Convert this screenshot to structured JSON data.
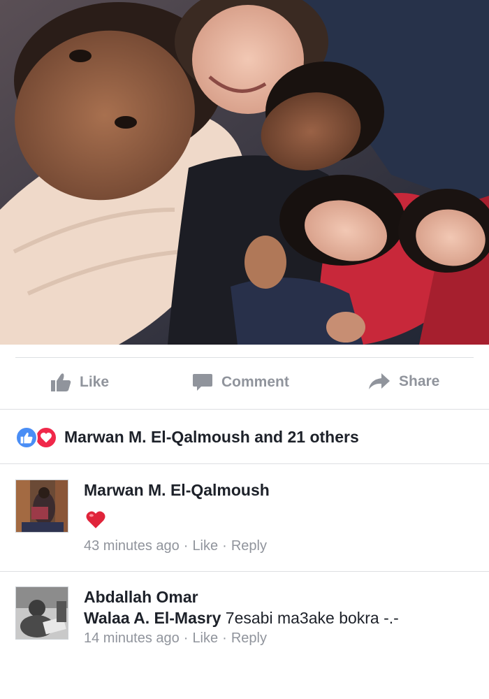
{
  "photo": {
    "alt_name": "group-selfie-photo"
  },
  "actions": {
    "like_label": "Like",
    "comment_label": "Comment",
    "share_label": "Share"
  },
  "reactions": {
    "summary": "Marwan M. El-Qalmoush and 21 others",
    "icons": [
      "like-reaction-icon",
      "love-reaction-icon"
    ]
  },
  "comments": [
    {
      "author": "Marwan M. El-Qalmoush",
      "content_icon": "red-heart-emoji",
      "time": "43 minutes ago",
      "like_label": "Like",
      "reply_label": "Reply"
    },
    {
      "author": "Abdallah Omar",
      "mention": "Walaa A. El-Masry",
      "text": " 7esabi ma3ake bokra -.-",
      "time": "14 minutes ago",
      "like_label": "Like",
      "reply_label": "Reply"
    }
  ],
  "colors": {
    "muted_text": "#90949c",
    "like_blue": "#4a8ef5",
    "love_red": "#f0284a",
    "divider": "#dddfe2"
  }
}
